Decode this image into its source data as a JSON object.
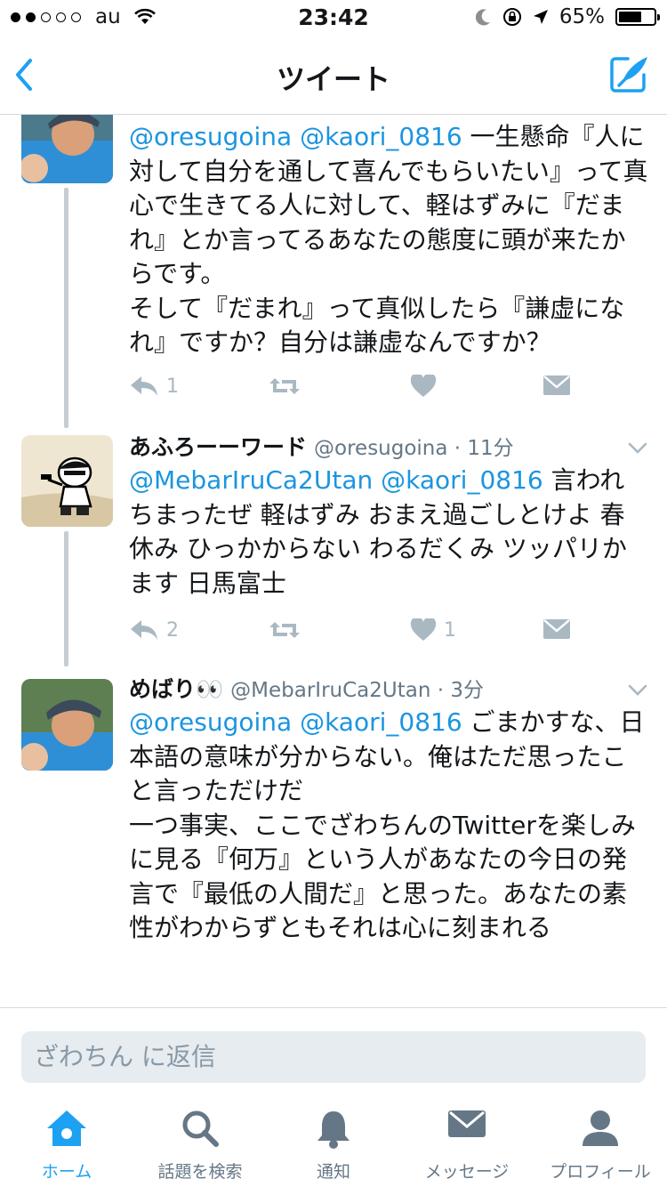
{
  "status_bar": {
    "carrier": "au",
    "time": "23:42",
    "battery": "65%",
    "battery_level": 0.65
  },
  "nav": {
    "title": "ツイート"
  },
  "tweets": [
    {
      "mentions": "@oresugoina @kaori_0816",
      "text": " 一生懸命『人に対して自分を通して喜んでもらいたい』って真心で生きてる人に対して、軽はずみに『だまれ』とか言ってるあなたの態度に頭が来たからです。\nそして『だまれ』って真似したら『謙虚になれ』ですか？自分は謙虚なんですか？",
      "reply_count": "1",
      "like_count": ""
    },
    {
      "name": "あふろーーワード",
      "handle": "@oresugoina · 11分",
      "mentions": "@MebarIruCa2Utan @kaori_0816",
      "text": " 言われちまったぜ 軽はずみ おまえ過ごしとけよ 春休み ひっかからない わるだくみ ツッパリかます 日馬富士",
      "reply_count": "2",
      "like_count": "1"
    },
    {
      "name": "めばり👀",
      "handle": "@MebarIruCa2Utan · 3分",
      "mentions": "@oresugoina @kaori_0816",
      "text": " ごまかすな、日本語の意味が分からない。俺はただ思ったこと言っただけだ\n一つ事実、ここでざわちんのTwitterを楽しみに見る『何万』という人があなたの今日の発言で『最低の人間だ』と思った。あなたの素性がわからずともそれは心に刻まれる"
    }
  ],
  "reply": {
    "placeholder": "ざわちん に返信"
  },
  "tabs": [
    {
      "label": "ホーム",
      "icon": "home-icon"
    },
    {
      "label": "話題を検索",
      "icon": "search-icon"
    },
    {
      "label": "通知",
      "icon": "bell-icon"
    },
    {
      "label": "メッセージ",
      "icon": "envelope-icon"
    },
    {
      "label": "プロフィール",
      "icon": "person-icon"
    }
  ],
  "colors": {
    "accent": "#1da1f2",
    "mention": "#1b95e0",
    "muted": "#657786",
    "action": "#aab8c2"
  }
}
